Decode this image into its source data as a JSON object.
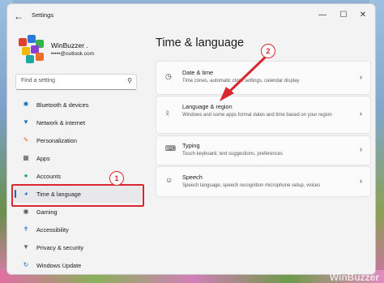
{
  "window": {
    "title": "Settings"
  },
  "profile": {
    "name": "WinBuzzer .",
    "email": "•••••@outlook.com"
  },
  "search": {
    "placeholder": "Find a setting"
  },
  "nav": {
    "items": [
      {
        "label": "Bluetooth & devices",
        "icon": "bluetooth-icon"
      },
      {
        "label": "Network & internet",
        "icon": "wifi-icon"
      },
      {
        "label": "Personalization",
        "icon": "brush-icon"
      },
      {
        "label": "Apps",
        "icon": "apps-icon"
      },
      {
        "label": "Accounts",
        "icon": "person-icon"
      },
      {
        "label": "Time & language",
        "icon": "globe-clock-icon",
        "active": true
      },
      {
        "label": "Gaming",
        "icon": "gamepad-icon"
      },
      {
        "label": "Accessibility",
        "icon": "accessibility-icon"
      },
      {
        "label": "Privacy & security",
        "icon": "shield-icon"
      },
      {
        "label": "Windows Update",
        "icon": "update-icon"
      }
    ]
  },
  "main": {
    "title": "Time & language",
    "cards": [
      {
        "title": "Date & time",
        "desc": "Time zones, automatic clock settings, calendar display",
        "icon": "clock-icon"
      },
      {
        "title": "Language & region",
        "desc": "Windows and some apps format dates and time based on your region",
        "icon": "language-icon"
      },
      {
        "title": "Typing",
        "desc": "Touch keyboard, text suggestions, preferences",
        "icon": "keyboard-icon"
      },
      {
        "title": "Speech",
        "desc": "Speech language, speech recognition microphone setup, voices",
        "icon": "speech-icon"
      }
    ]
  },
  "annotations": {
    "badge1": "1",
    "badge2": "2",
    "color": "#d9262f"
  },
  "watermark": "WinBuzzer",
  "accent": "#0067c0"
}
